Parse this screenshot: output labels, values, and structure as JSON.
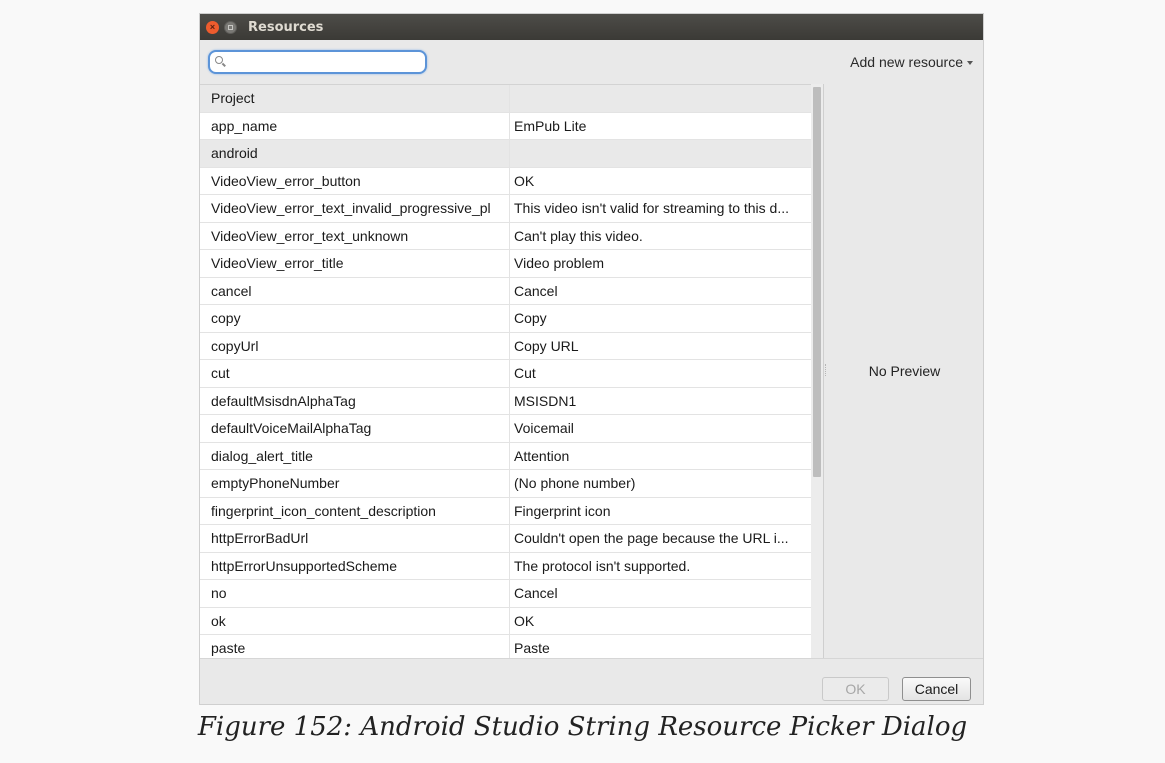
{
  "window": {
    "title": "Resources"
  },
  "search": {
    "value": "",
    "placeholder": ""
  },
  "toolbar": {
    "add_new_label": "Add new resource"
  },
  "table": {
    "rows": [
      {
        "group": true,
        "name": "Project",
        "value": ""
      },
      {
        "group": false,
        "name": "app_name",
        "value": "EmPub Lite"
      },
      {
        "group": true,
        "name": "android",
        "value": ""
      },
      {
        "group": false,
        "name": "VideoView_error_button",
        "value": "OK"
      },
      {
        "group": false,
        "name": "VideoView_error_text_invalid_progressive_pl",
        "value": "This video isn't valid for streaming to this d..."
      },
      {
        "group": false,
        "name": "VideoView_error_text_unknown",
        "value": "Can't play this video."
      },
      {
        "group": false,
        "name": "VideoView_error_title",
        "value": "Video problem"
      },
      {
        "group": false,
        "name": "cancel",
        "value": "Cancel"
      },
      {
        "group": false,
        "name": "copy",
        "value": "Copy"
      },
      {
        "group": false,
        "name": "copyUrl",
        "value": "Copy URL"
      },
      {
        "group": false,
        "name": "cut",
        "value": "Cut"
      },
      {
        "group": false,
        "name": "defaultMsisdnAlphaTag",
        "value": "MSISDN1"
      },
      {
        "group": false,
        "name": "defaultVoiceMailAlphaTag",
        "value": "Voicemail"
      },
      {
        "group": false,
        "name": "dialog_alert_title",
        "value": "Attention"
      },
      {
        "group": false,
        "name": "emptyPhoneNumber",
        "value": "(No phone number)"
      },
      {
        "group": false,
        "name": "fingerprint_icon_content_description",
        "value": "Fingerprint icon"
      },
      {
        "group": false,
        "name": "httpErrorBadUrl",
        "value": "Couldn't open the page because the URL i..."
      },
      {
        "group": false,
        "name": "httpErrorUnsupportedScheme",
        "value": "The protocol isn't supported."
      },
      {
        "group": false,
        "name": "no",
        "value": "Cancel"
      },
      {
        "group": false,
        "name": "ok",
        "value": "OK"
      },
      {
        "group": false,
        "name": "paste",
        "value": "Paste"
      },
      {
        "group": false,
        "name": "",
        "value": ""
      }
    ]
  },
  "preview": {
    "text": "No Preview"
  },
  "buttons": {
    "ok_label": "OK",
    "cancel_label": "Cancel"
  },
  "caption": "Figure 152: Android Studio String Resource Picker Dialog",
  "colors": {
    "focus_ring": "#5c94d8",
    "close_button": "#ee5c2e",
    "titlebar": "#3b3a36"
  },
  "icons": {
    "search": "search-icon",
    "close": "close-icon",
    "minimize": "minimize-icon",
    "dropdown": "chevron-down-icon"
  }
}
